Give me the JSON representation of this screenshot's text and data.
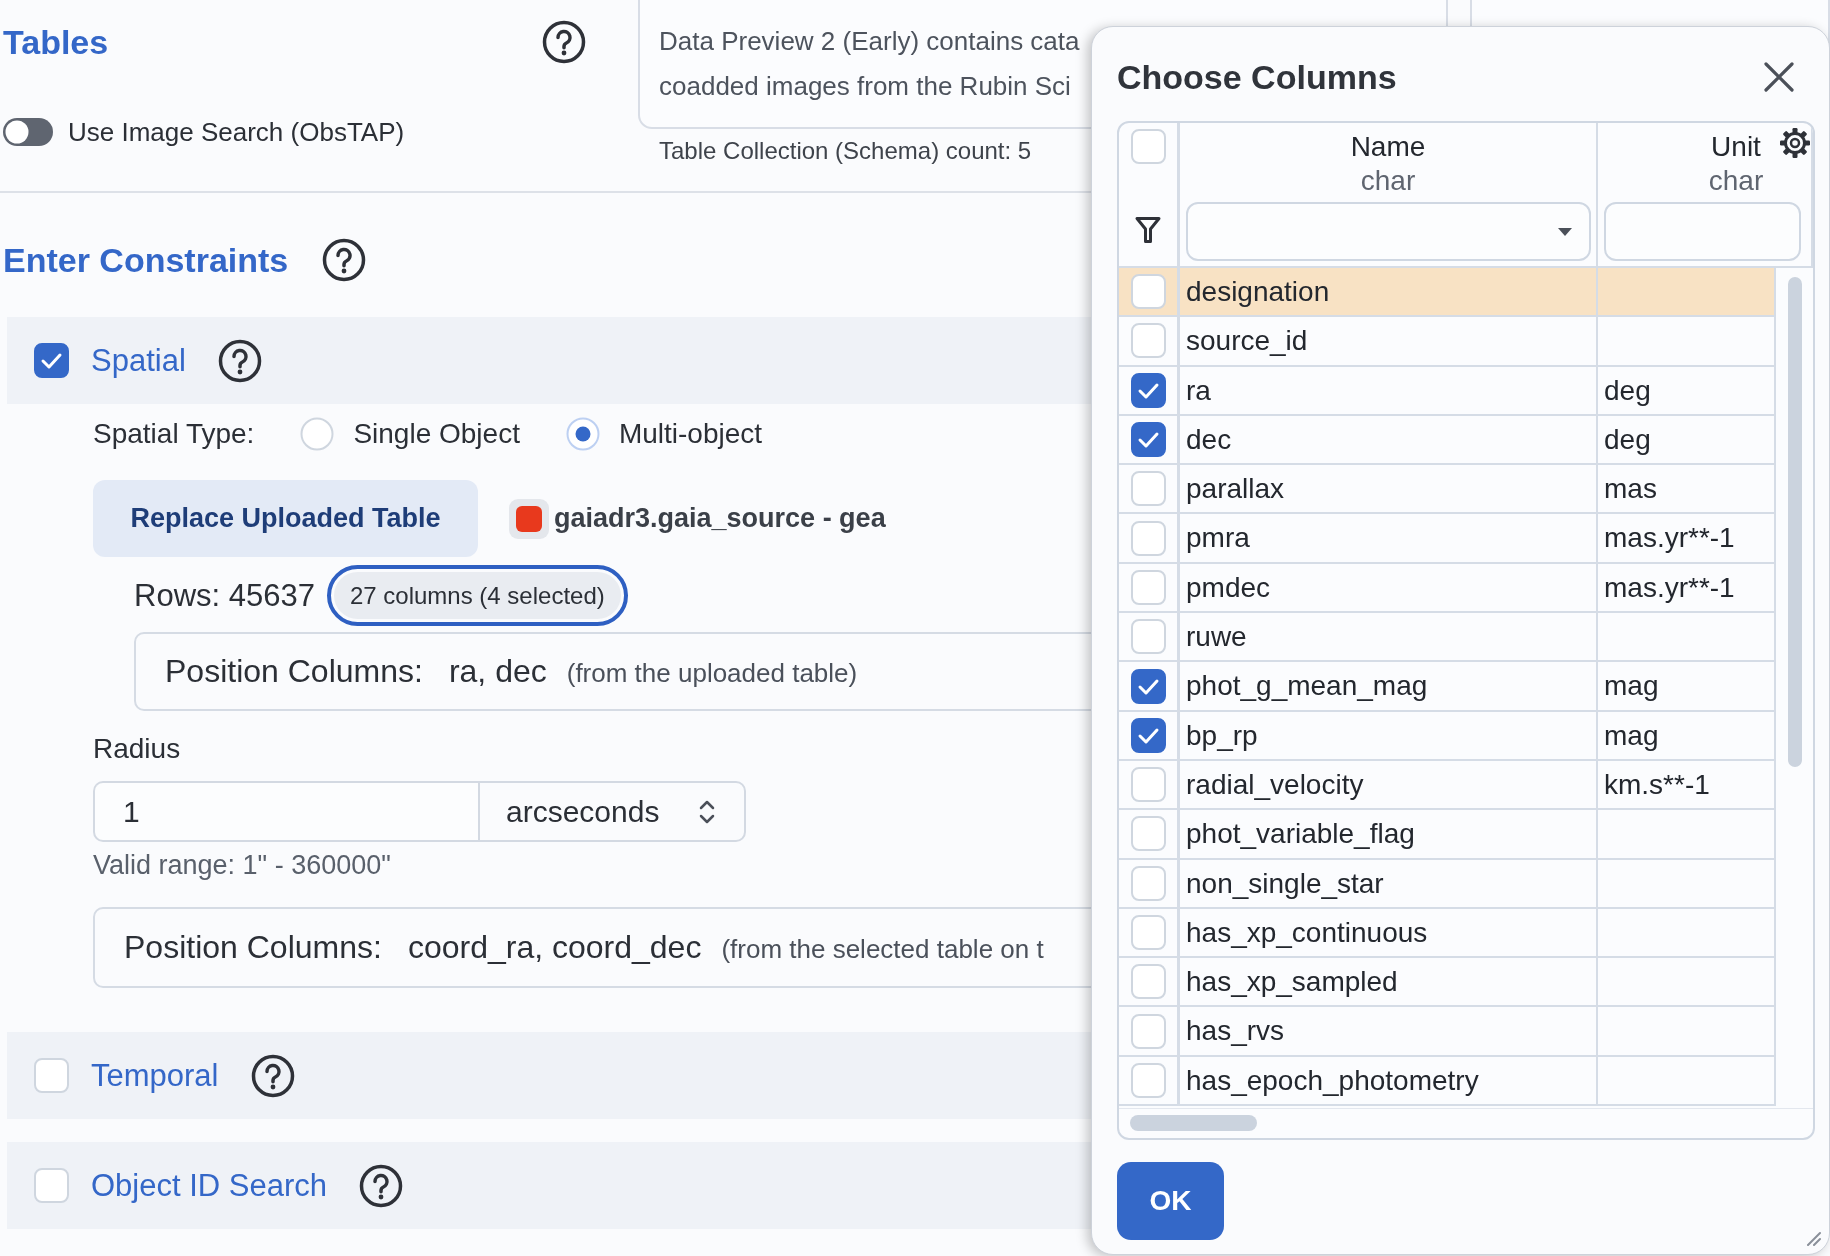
{
  "tables_panel": {
    "title": "Tables",
    "image_search": {
      "label": "Use Image Search (ObsTAP)",
      "on": false
    }
  },
  "schema_card": {
    "description": [
      "Data Preview 2 (Early) contains cata",
      "coadded images from the Rubin Sci"
    ],
    "footer": "Table Collection (Schema) count: 5"
  },
  "constraints": {
    "title": "Enter Constraints",
    "sections": [
      {
        "kind": "spatial",
        "title": "Spatial",
        "checked": true,
        "spatial_type": {
          "label": "Spatial Type:",
          "options": [
            {
              "label": "Single Object",
              "selected": false
            },
            {
              "label": "Multi-object",
              "selected": true
            }
          ]
        },
        "upload": {
          "button": "Replace Uploaded Table",
          "file": "gaiadr3.gaia_source - gea",
          "rows": "Rows: 45637",
          "columns_button": {
            "label": "27 columns (4 selected)",
            "focused": true
          }
        },
        "upload_position": {
          "label": "Position Columns:",
          "value": "ra, dec",
          "note": "(from the uploaded table)"
        },
        "radius": {
          "label": "Radius",
          "value": "1",
          "unit": "arcseconds",
          "hint": "Valid range: 1\" - 360000\""
        },
        "table_position": {
          "label": "Position Columns:",
          "value": "coord_ra, coord_dec",
          "note": "(from the selected table on t"
        }
      },
      {
        "kind": "temporal",
        "title": "Temporal",
        "checked": false
      },
      {
        "kind": "object_id",
        "title": "Object ID Search",
        "checked": false
      }
    ]
  },
  "dialog": {
    "title": "Choose Columns",
    "select_all": {
      "checked": false
    },
    "columns": [
      {
        "label": "Name",
        "type": "char",
        "kind": "dropdown"
      },
      {
        "label": "Unit",
        "type": "char",
        "kind": "text"
      }
    ],
    "rows": [
      {
        "name": "designation",
        "checked": false,
        "selected": true
      },
      {
        "name": "source_id",
        "checked": false,
        "selected": false
      },
      {
        "name": "ra",
        "unit": "deg",
        "checked": true,
        "selected": false
      },
      {
        "name": "dec",
        "unit": "deg",
        "checked": true,
        "selected": false
      },
      {
        "name": "parallax",
        "unit": "mas",
        "checked": false,
        "selected": false
      },
      {
        "name": "pmra",
        "unit": "mas.yr**-1",
        "checked": false,
        "selected": false
      },
      {
        "name": "pmdec",
        "unit": "mas.yr**-1",
        "checked": false,
        "selected": false
      },
      {
        "name": "ruwe",
        "checked": false,
        "selected": false
      },
      {
        "name": "phot_g_mean_mag",
        "unit": "mag",
        "checked": true,
        "selected": false
      },
      {
        "name": "bp_rp",
        "unit": "mag",
        "checked": true,
        "selected": false
      },
      {
        "name": "radial_velocity",
        "unit": "km.s**-1",
        "checked": false,
        "selected": false
      },
      {
        "name": "phot_variable_flag",
        "checked": false,
        "selected": false
      },
      {
        "name": "non_single_star",
        "checked": false,
        "selected": false
      },
      {
        "name": "has_xp_continuous",
        "checked": false,
        "selected": false
      },
      {
        "name": "has_xp_sampled",
        "checked": false,
        "selected": false
      },
      {
        "name": "has_rvs",
        "checked": false,
        "selected": false
      },
      {
        "name": "has_epoch_photometry",
        "checked": false,
        "selected": false
      }
    ],
    "ok_button": "OK"
  }
}
